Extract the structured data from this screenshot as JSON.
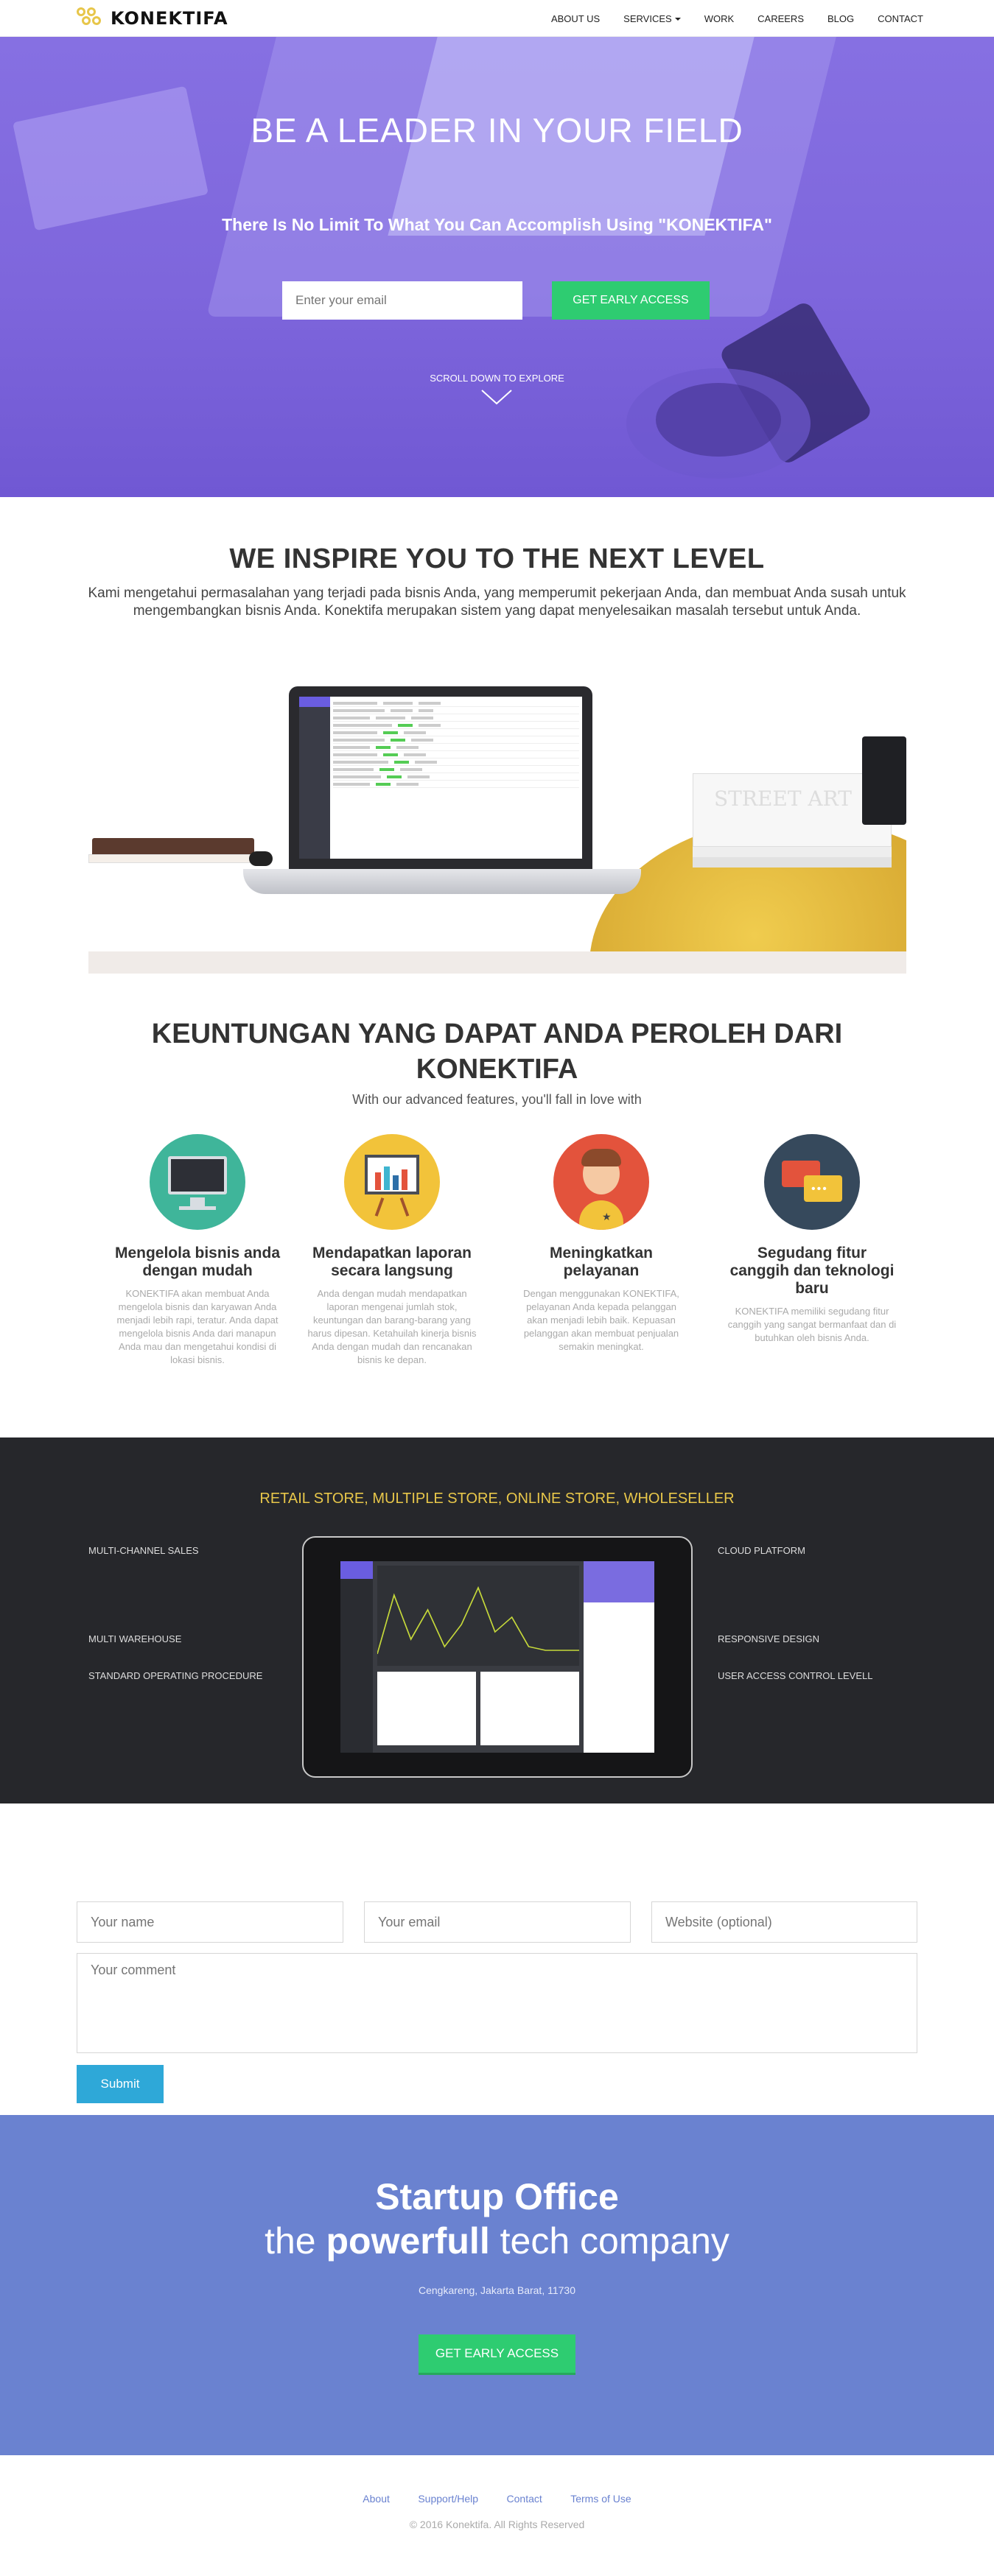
{
  "nav": {
    "brand": "KONEKTIFA",
    "items": [
      "ABOUT US",
      "SERVICES",
      "WORK",
      "CAREERS",
      "BLOG",
      "CONTACT"
    ]
  },
  "hero": {
    "title": "BE A LEADER IN YOUR FIELD",
    "subtitle": "There Is No Limit To What You Can Accomplish Using \"KONEKTIFA\"",
    "email_placeholder": "Enter your email",
    "button": "GET EARLY ACCESS",
    "scroll_text": "SCROLL DOWN TO EXPLORE"
  },
  "inspire": {
    "title": "WE INSPIRE YOU TO THE NEXT LEVEL",
    "text": "Kami mengetahui permasalahan yang terjadi pada bisnis Anda, yang memperumit pekerjaan Anda, dan membuat Anda susah untuk mengembangkan bisnis Anda. Konektifa merupakan sistem yang dapat menyelesaikan masalah tersebut untuk Anda.",
    "scene_books_title": "STREET ART"
  },
  "benefits": {
    "title": "KEUNTUNGAN YANG DAPAT ANDA PEROLEH DARI KONEKTIFA",
    "subtitle": "With our advanced features, you'll fall in love with",
    "features": [
      {
        "icon": "monitor-icon",
        "color": "#3fb59a",
        "title": "Mengelola bisnis anda dengan mudah",
        "text": "KONEKTIFA akan membuat Anda mengelola bisnis dan karyawan Anda menjadi lebih rapi, teratur. Anda dapat mengelola bisnis Anda dari manapun Anda mau dan mengetahui kondisi di lokasi bisnis."
      },
      {
        "icon": "presentation-chart-icon",
        "color": "#f2c33a",
        "title": "Mendapatkan laporan secara langsung",
        "text": "Anda dengan mudah mendapatkan laporan mengenai jumlah stok, keuntungan dan barang-barang yang harus dipesan. Ketahuilah kinerja bisnis Anda dengan mudah dan rencanakan bisnis ke depan."
      },
      {
        "icon": "user-star-icon",
        "color": "#e3533c",
        "title": "Meningkatkan pelayanan",
        "text": "Dengan menggunakan KONEKTIFA, pelayanan Anda kepada pelanggan akan menjadi lebih baik. Kepuasan pelanggan akan membuat penjualan semakin meningkat."
      },
      {
        "icon": "chat-bubbles-icon",
        "color": "#36495c",
        "title": "Segudang fitur canggih dan teknologi baru",
        "text": "KONEKTIFA memiliki segudang fitur canggih yang sangat bermanfaat dan di butuhkan oleh bisnis Anda."
      }
    ]
  },
  "platform": {
    "title": "RETAIL STORE, MULTIPLE STORE, ONLINE STORE, WHOLESELLER",
    "left": [
      "MULTI-CHANNEL SALES",
      "MULTI WAREHOUSE",
      "STANDARD OPERATING PROCEDURE"
    ],
    "right": [
      "CLOUD PLATFORM",
      "RESPONSIVE DESIGN",
      "USER ACCESS CONTROL LEVELL"
    ]
  },
  "form": {
    "name_placeholder": "Your name",
    "email_placeholder": "Your email",
    "website_placeholder": "Website (optional)",
    "comment_placeholder": "Your comment",
    "submit": "Submit"
  },
  "startup": {
    "title": "Startup Office",
    "tag_pre": "the",
    "tag_bold": "powerfull",
    "tag_post": "tech company",
    "address": "Cengkareng, Jakarta Barat, 11730",
    "button": "GET EARLY ACCESS"
  },
  "footer": {
    "links": [
      "About",
      "Support/Help",
      "Contact",
      "Terms of Use"
    ],
    "copyright": "© 2016 Konektifa. All Rights Reserved"
  },
  "colors": {
    "hero": "#7a62e0",
    "accent_green": "#2ecc71",
    "dark_section": "#26272b",
    "dark_title": "#e8c74a",
    "startup_bg": "#6a82d0",
    "submit": "#2ea8d8"
  }
}
